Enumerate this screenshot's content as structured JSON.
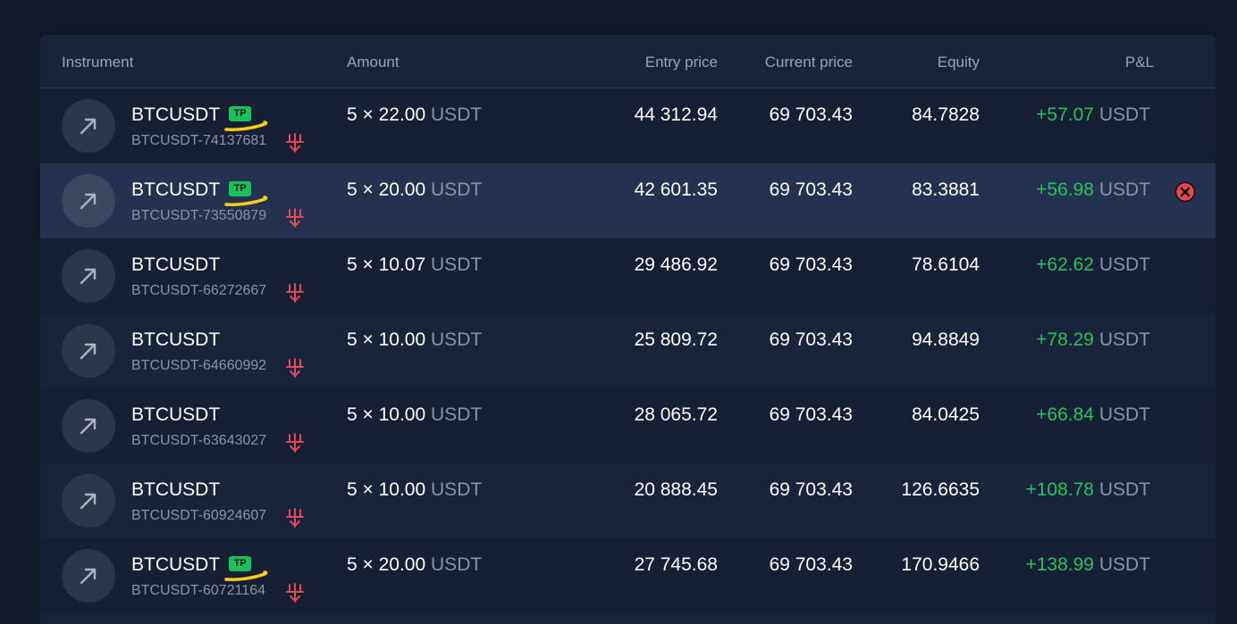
{
  "columns": {
    "instrument": "Instrument",
    "amount": "Amount",
    "entry_price": "Entry price",
    "current_price": "Current price",
    "equity": "Equity",
    "pnl": "P&L"
  },
  "units": {
    "usdt": "USDT"
  },
  "badge_label": "TP",
  "colors": {
    "background": "#111827",
    "panel": "#19233a",
    "highlight_row": "#243150",
    "profit_green": "#22c55e",
    "tp_badge": "#17c25a",
    "close_red": "#ef4444",
    "annotation_yellow": "#facc15"
  },
  "icons": {
    "direction": "arrow-up-right-icon",
    "trade_type": "trade-options-icon",
    "close": "close-circle-icon"
  },
  "rows": [
    {
      "instrument": "BTCUSDT",
      "tp": true,
      "id": "BTCUSDT-74137681",
      "amount": "5 × 22.00",
      "entry": "44 312.94",
      "current": "69 703.43",
      "equity": "84.7828",
      "pnl": "+57.07",
      "highlighted": false
    },
    {
      "instrument": "BTCUSDT",
      "tp": true,
      "id": "BTCUSDT-73550879",
      "amount": "5 × 20.00",
      "entry": "42 601.35",
      "current": "69 703.43",
      "equity": "83.3881",
      "pnl": "+56.98",
      "highlighted": true
    },
    {
      "instrument": "BTCUSDT",
      "tp": false,
      "id": "BTCUSDT-66272667",
      "amount": "5 × 10.07",
      "entry": "29 486.92",
      "current": "69 703.43",
      "equity": "78.6104",
      "pnl": "+62.62",
      "highlighted": false
    },
    {
      "instrument": "BTCUSDT",
      "tp": false,
      "id": "BTCUSDT-64660992",
      "amount": "5 × 10.00",
      "entry": "25 809.72",
      "current": "69 703.43",
      "equity": "94.8849",
      "pnl": "+78.29",
      "highlighted": false
    },
    {
      "instrument": "BTCUSDT",
      "tp": false,
      "id": "BTCUSDT-63643027",
      "amount": "5 × 10.00",
      "entry": "28 065.72",
      "current": "69 703.43",
      "equity": "84.0425",
      "pnl": "+66.84",
      "highlighted": false
    },
    {
      "instrument": "BTCUSDT",
      "tp": false,
      "id": "BTCUSDT-60924607",
      "amount": "5 × 10.00",
      "entry": "20 888.45",
      "current": "69 703.43",
      "equity": "126.6635",
      "pnl": "+108.78",
      "highlighted": false
    },
    {
      "instrument": "BTCUSDT",
      "tp": true,
      "id": "BTCUSDT-60721164",
      "amount": "5 × 20.00",
      "entry": "27 745.68",
      "current": "69 703.43",
      "equity": "170.9466",
      "pnl": "+138.99",
      "highlighted": false
    }
  ]
}
